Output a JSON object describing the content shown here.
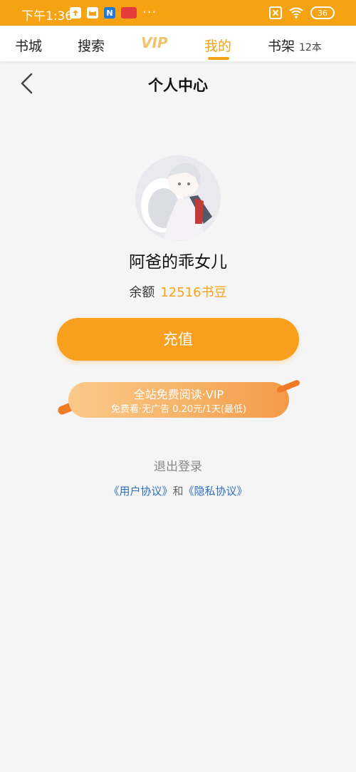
{
  "status_bar": {
    "time": "下午1:36",
    "battery": "36",
    "icons": [
      "upload-icon",
      "cat-app-icon",
      "n-app-icon",
      "red-app-icon",
      "more-dots-icon",
      "sim-icon",
      "wifi-icon",
      "battery-icon"
    ],
    "app_icon_letter": "N",
    "more_dots": "···"
  },
  "nav": {
    "tabs": [
      {
        "label": "书城"
      },
      {
        "label": "搜索"
      },
      {
        "label": "VIP"
      },
      {
        "label": "我的"
      },
      {
        "label": "书架"
      }
    ],
    "shelf_count": "12本",
    "active_tab": "我的",
    "active_color": "#f6a313"
  },
  "header": {
    "title": "个人中心"
  },
  "profile": {
    "username": "阿爸的乖女儿",
    "balance_label": "余额",
    "balance_value": "12516书豆"
  },
  "actions": {
    "recharge_label": "充值"
  },
  "vip_banner": {
    "main_text": "全站免费阅读·VIP",
    "sub_text": "免费看·无广告 0.20元/1天(最低)"
  },
  "footer": {
    "logout_label": "退出登录",
    "user_agreement": "《用户协议》",
    "connector": "和",
    "privacy_agreement": "《隐私协议》"
  },
  "colors": {
    "brand": "#f6a313",
    "link": "#2f6fc4"
  }
}
